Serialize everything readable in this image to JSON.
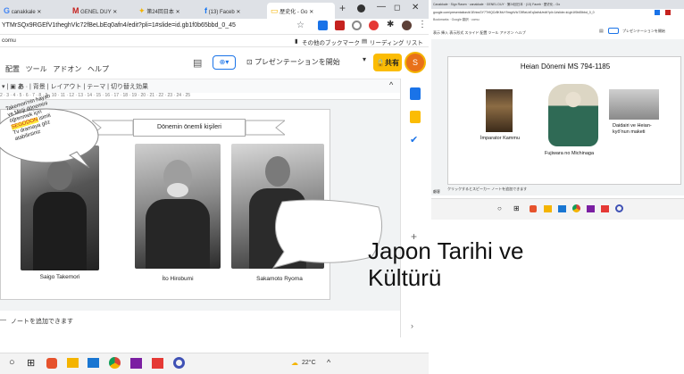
{
  "left": {
    "tabs": [
      {
        "label": "canakkale",
        "icon": "google-icon"
      },
      {
        "label": "GENEL DUY",
        "icon": "gmail-icon"
      },
      {
        "label": "第24回日本",
        "icon": "star-icon"
      },
      {
        "label": "(13) Faceb",
        "icon": "facebook-icon"
      },
      {
        "label": "歴史化 - Go",
        "icon": "slides-icon"
      }
    ],
    "address": "YTMrSQx9RGEfV1theghVlc72fBeLbEq0afn4/edit?pli=1#slide=id.gb1f0b65bbd_0_45",
    "bookmarks_text": "その他のブックマーク",
    "reading_list": "リーディング リスト",
    "bookmark_left": "comu",
    "menu": [
      "配置",
      "ツール",
      "アドオン",
      "ヘルプ"
    ],
    "present_label": "プレゼンテーションを開始",
    "share_label": "共有",
    "avatar_letter": "S",
    "toolbar": {
      "bg": "背景",
      "layout": "レイアウト",
      "theme": "テーマ",
      "transition": "切り替え効果"
    },
    "ruler": "2 · 3 · 4 · 5 · 6 · 7 · 8 · 9 · 10 · 11 · 12 · 13 · 14 · 15 · 16 · 17 · 18 · 19 · 20 · 21 · 22 · 23 · 24 · 25",
    "slide": {
      "bubble": [
        "Takemori'nin hayatı",
        "ve Meiji dönemini",
        "öğrenmek için",
        "SEGODON",
        "isimli",
        "Tv dramaya göz",
        "atabilirsiniz"
      ],
      "banner": "Dönemin önemli kişileri",
      "people": [
        "Saigo Takemori",
        "İto Hirobumi",
        "Sakamoto Ryoma"
      ]
    },
    "notes": "ノートを追加できます"
  },
  "right": {
    "tabs": "Canakkale · Sign Rasen · canakkale · GENEL DUY · 第24回日本 · (13) Faceb · 歴史化 - Go",
    "address": "google.com/presentation/d/1ErkwGY7Tr9QCr8KMvY9mghVlc72fBeLbEq0afn4/edit?pli=1#slide=id.gb1f0b65bbd_0_0",
    "bookmarks": "Bookmarks · Google 翻訳 · comu",
    "menu": "表示 挿入 表示形式 スライド 配置 ツール アドオン ヘルプ",
    "present_label": "プレゼンテーションを開始",
    "slide": {
      "title": "Heian Dönemi MS 794-1185",
      "labels": [
        "İmparator Kammu",
        "Fujiwara no Michinaga",
        "Daidairi ve Heian-kyō'nun maketi"
      ]
    },
    "notes": "クリックするとスピーカー ノートを追加できます",
    "notes_label": "顧客"
  },
  "overlay_title": [
    "Japon Tarihi ve",
    "Kültürü"
  ],
  "taskbar": {
    "temp": "22°C"
  }
}
